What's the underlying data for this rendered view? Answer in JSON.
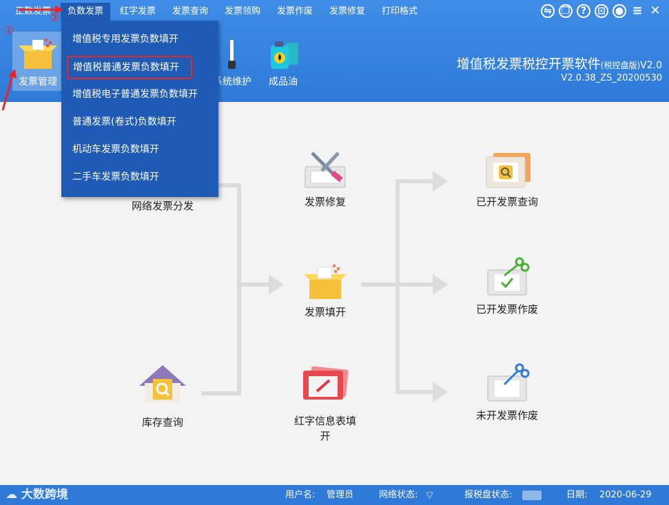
{
  "menubar": {
    "items": [
      "正数发票",
      "负数发票",
      "红字发票",
      "发票查询",
      "发票领购",
      "发票作废",
      "发票修复",
      "打印格式"
    ],
    "active_index": 1
  },
  "window_icons": [
    "swap-icon",
    "copy-icon",
    "help-icon",
    "lock-icon",
    "user-icon",
    "menu-icon",
    "close-icon"
  ],
  "toolbar": {
    "buttons": [
      "发票管理",
      "系统维护",
      "成品油"
    ]
  },
  "app": {
    "title": "增值税发票税控开票软件",
    "title_suffix": "(税控盘版)",
    "title_ver": "V2.0",
    "version": "V2.0.38_ZS_20200530"
  },
  "dropdown": {
    "items": [
      "增值税专用发票负数填开",
      "增值税普通发票负数填开",
      "增值税电子普通发票负数填开",
      "普通发票(卷式)负数填开",
      "机动车发票负数填开",
      "二手车发票负数填开"
    ],
    "highlighted_index": 1
  },
  "flow": {
    "nodes": {
      "distribute": "网络发票分发",
      "repair": "发票修复",
      "fill": "发票填开",
      "inventory": "库存查询",
      "red_info": "红字信息表填开",
      "issued_query": "已开发票查询",
      "issued_void": "已开发票作废",
      "unissued_void": "未开发票作废"
    }
  },
  "status": {
    "brand": "大数跨境",
    "user_label": "用户名:",
    "user_value": "管理员",
    "network_label": "网络状态:",
    "disk_label": "报税盘状态:",
    "date_label": "日期:",
    "date_value": "2020-06-29"
  },
  "annotations": {
    "step1": "①",
    "step2": "②"
  },
  "colors": {
    "header": "#2f7ad9",
    "dropdown": "#1f5bb5",
    "highlight": "#e8262a"
  }
}
